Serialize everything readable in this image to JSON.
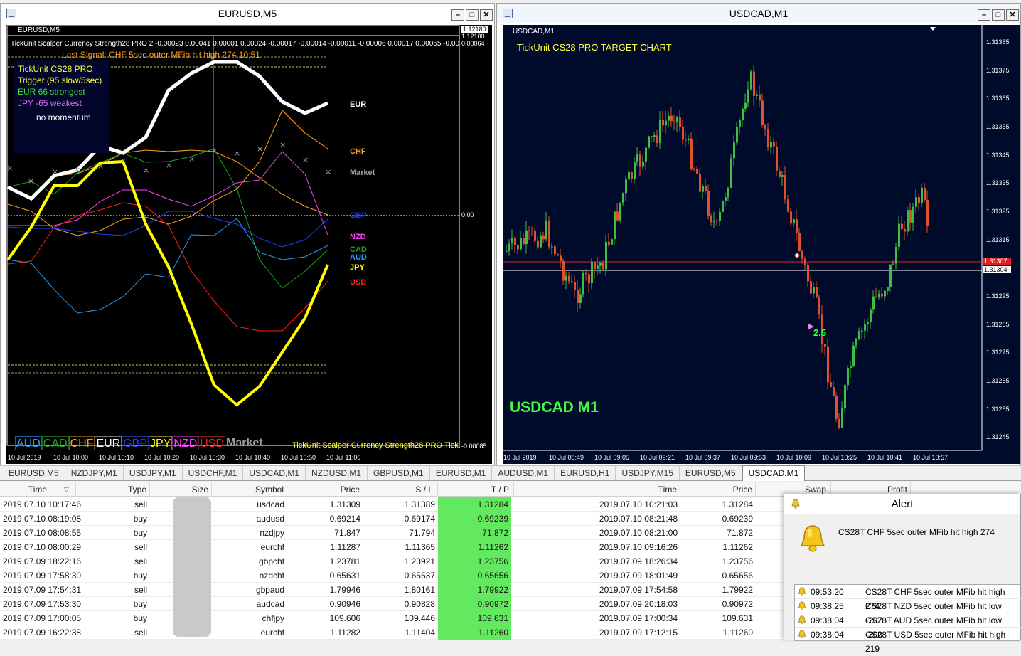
{
  "left_window": {
    "title": "EURUSD,M5",
    "chart_label": "EURUSD,M5",
    "indicator_line": "TickUnit Scalper Currency Strength28 PRO 2 -0.00023 0.00041 0.00001 0.00024 -0.00017 -0.00014 -0.00011 -0.00006 0.00017 0.00055 -0.00055 0.00064",
    "last_signal": "Last Signal:  CHF 5sec outer MFib hit high 274.10:51",
    "info_box": {
      "line1": "TickUnit CS28 PRO",
      "line2": "Trigger (95 slow/5sec)",
      "line3": "EUR 66 strongest",
      "line4": "JPY -65 weakest",
      "line5": "no momentum"
    },
    "price_top": "1.12180",
    "price_2": "1.12100",
    "scale_top": "0.00064",
    "scale_zero": "0.00",
    "scale_bottom": "-0.00085",
    "currency_labels": [
      {
        "name": "EUR",
        "color": "#ffffff"
      },
      {
        "name": "CHF",
        "color": "#ff9f1f"
      },
      {
        "name": "Market",
        "color": "#a0a0a0"
      },
      {
        "name": "GBP",
        "color": "#1f3fff"
      },
      {
        "name": "NZD",
        "color": "#ff3fff"
      },
      {
        "name": "CAD",
        "color": "#1fa01f"
      },
      {
        "name": "AUD",
        "color": "#1fa0ff"
      },
      {
        "name": "JPY",
        "color": "#ffff00"
      },
      {
        "name": "USD",
        "color": "#ff1f1f"
      }
    ],
    "legend": [
      {
        "name": "AUD",
        "color": "#1fa0ff"
      },
      {
        "name": "CAD",
        "color": "#1fa01f"
      },
      {
        "name": "CHF",
        "color": "#ff9f1f"
      },
      {
        "name": "EUR",
        "color": "#ffffff"
      },
      {
        "name": "GBP",
        "color": "#1f3fff"
      },
      {
        "name": "JPY",
        "color": "#ffff00"
      },
      {
        "name": "NZD",
        "color": "#ff3fff"
      },
      {
        "name": "USD",
        "color": "#ff1f1f"
      },
      {
        "name": "Market",
        "color": "#a0a0a0"
      }
    ],
    "footer_text": "TickUnit Scalper Currency Strength28 PRO  Ticku",
    "time_axis": [
      "10 Jul 2019",
      "10 Jul 10:00",
      "10 Jul 10:10",
      "10 Jul 10:20",
      "10 Jul 10:30",
      "10 Jul 10:40",
      "10 Jul 10:50",
      "10 Jul 11:00"
    ]
  },
  "right_window": {
    "title": "USDCAD,M1",
    "chart_label": "USDCAD,M1",
    "header_text": "TickUnit CS28 PRO TARGET-CHART",
    "big_label": "USDCAD M1",
    "target_label": "2.5",
    "price_axis": [
      "1.31385",
      "1.31375",
      "1.31365",
      "1.31355",
      "1.31345",
      "1.31335",
      "1.31325",
      "1.31315",
      "1.31295",
      "1.31285",
      "1.31275",
      "1.31265",
      "1.31255",
      "1.31245"
    ],
    "red_price": "1.31307",
    "white_price": "1.31304",
    "time_axis": [
      "10 Jul 2019",
      "10 Jul 08:49",
      "10 Jul 09:05",
      "10 Jul 09:21",
      "10 Jul 09:37",
      "10 Jul 09:53",
      "10 Jul 10:09",
      "10 Jul 10:25",
      "10 Jul 10:41",
      "10 Jul 10:57"
    ]
  },
  "tabs": [
    "EURUSD,M5",
    "NZDJPY,M1",
    "USDJPY,M1",
    "USDCHF,M1",
    "USDCAD,M1",
    "NZDUSD,M1",
    "GBPUSD,M1",
    "EURUSD,M1",
    "AUDUSD,M1",
    "EURUSD,H1",
    "USDJPY,M15",
    "EURUSD,M5",
    "USDCAD,M1"
  ],
  "active_tab_index": 12,
  "table": {
    "headers": {
      "time": "Time",
      "type": "Type",
      "size": "Size",
      "symbol": "Symbol",
      "price": "Price",
      "sl": "S / L",
      "tp": "T / P",
      "close_time": "Time",
      "close_price": "Price",
      "swap": "Swap",
      "profit": "Profit"
    },
    "rows": [
      {
        "time": "2019.07.10 10:17:46",
        "type": "sell",
        "symbol": "usdcad",
        "price": "1.31309",
        "sl": "1.31389",
        "tp": "1.31284",
        "ctime": "2019.07.10 10:21:03",
        "cprice": "1.31284"
      },
      {
        "time": "2019.07.10 08:19:08",
        "type": "buy",
        "symbol": "audusd",
        "price": "0.69214",
        "sl": "0.69174",
        "tp": "0.69239",
        "ctime": "2019.07.10 08:21:48",
        "cprice": "0.69239"
      },
      {
        "time": "2019.07.10 08:08:55",
        "type": "buy",
        "symbol": "nzdjpy",
        "price": "71.847",
        "sl": "71.794",
        "tp": "71.872",
        "ctime": "2019.07.10 08:21:00",
        "cprice": "71.872"
      },
      {
        "time": "2019.07.10 08:00:29",
        "type": "sell",
        "symbol": "eurchf",
        "price": "1.11287",
        "sl": "1.11365",
        "tp": "1.11262",
        "ctime": "2019.07.10 09:16:26",
        "cprice": "1.11262"
      },
      {
        "time": "2019.07.09 18:22:16",
        "type": "sell",
        "symbol": "gbpchf",
        "price": "1.23781",
        "sl": "1.23921",
        "tp": "1.23756",
        "ctime": "2019.07.09 18:26:34",
        "cprice": "1.23756"
      },
      {
        "time": "2019.07.09 17:58:30",
        "type": "buy",
        "symbol": "nzdchf",
        "price": "0.65631",
        "sl": "0.65537",
        "tp": "0.65656",
        "ctime": "2019.07.09 18:01:49",
        "cprice": "0.65656"
      },
      {
        "time": "2019.07.09 17:54:31",
        "type": "sell",
        "symbol": "gbpaud",
        "price": "1.79946",
        "sl": "1.80161",
        "tp": "1.79922",
        "ctime": "2019.07.09 17:54:58",
        "cprice": "1.79922"
      },
      {
        "time": "2019.07.09 17:53:30",
        "type": "buy",
        "symbol": "audcad",
        "price": "0.90946",
        "sl": "0.90828",
        "tp": "0.90972",
        "ctime": "2019.07.09 20:18:03",
        "cprice": "0.90972"
      },
      {
        "time": "2019.07.09 17:00:05",
        "type": "buy",
        "symbol": "chfjpy",
        "price": "109.606",
        "sl": "109.446",
        "tp": "109.631",
        "ctime": "2019.07.09 17:00:34",
        "cprice": "109.631"
      },
      {
        "time": "2019.07.09 16:22:38",
        "type": "sell",
        "symbol": "eurchf",
        "price": "1.11282",
        "sl": "1.11404",
        "tp": "1.11260",
        "ctime": "2019.07.09 17:12:15",
        "cprice": "1.11260"
      }
    ]
  },
  "alert": {
    "title": "Alert",
    "message": "CS28T  CHF 5sec outer MFib hit high 274",
    "items": [
      {
        "time": "09:53:20",
        "text": "CS28T  CHF 5sec outer MFib hit high 274"
      },
      {
        "time": "09:38:25",
        "text": "CS28T  NZD 5sec outer MFib hit low -207"
      },
      {
        "time": "09:38:04",
        "text": "CS28T  AUD 5sec outer MFib hit low -300"
      },
      {
        "time": "09:38:04",
        "text": "CS28T  USD 5sec outer MFib hit high 219"
      }
    ]
  },
  "colors": {
    "tp_green": "#63e95f",
    "chart_bg_left": "#000000",
    "chart_bg_right": "#000a2a",
    "bull": "#3fbf3f",
    "bear": "#e0502a"
  }
}
